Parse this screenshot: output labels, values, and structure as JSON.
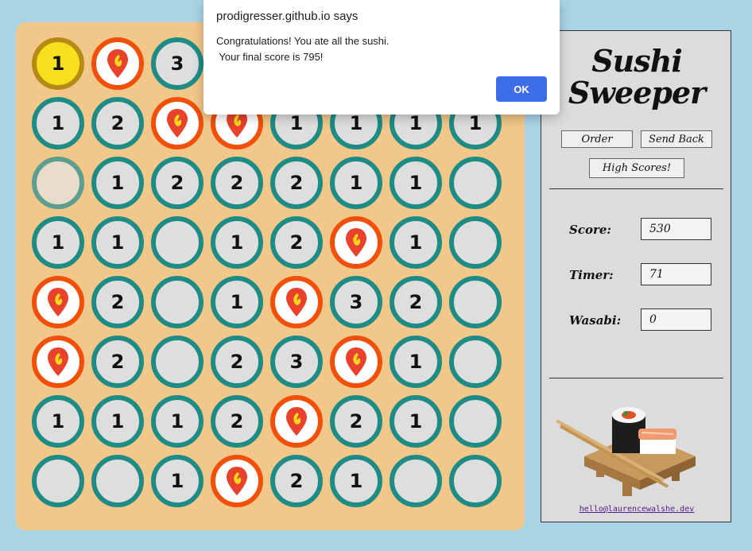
{
  "board": {
    "rows": [
      [
        "1",
        "sushi",
        "3",
        "",
        "",
        "",
        "",
        ""
      ],
      [
        "1",
        "2",
        "sushi",
        "sushi",
        "1",
        "1",
        "1",
        "1"
      ],
      [
        "",
        "1",
        "2",
        "2",
        "2",
        "1",
        "1",
        ""
      ],
      [
        "1",
        "1",
        "",
        "1",
        "2",
        "sushi",
        "1",
        ""
      ],
      [
        "sushi",
        "2",
        "",
        "1",
        "sushi",
        "3",
        "2",
        ""
      ],
      [
        "sushi",
        "2",
        "",
        "2",
        "3",
        "sushi",
        "1",
        ""
      ],
      [
        "1",
        "1",
        "1",
        "2",
        "sushi",
        "2",
        "1",
        ""
      ],
      [
        "",
        "",
        "1",
        "sushi",
        "2",
        "1",
        "",
        ""
      ]
    ],
    "highlighted_cell": "1",
    "sushi_icon": "sushi-icon",
    "colors": {
      "cell_border": "#1e8c84",
      "sushi_border": "#f0500a",
      "highlight_fill": "#f8e01e",
      "board_bg": "#f2c78a"
    }
  },
  "panel": {
    "title_line1": "Sushi",
    "title_line2": "Sweeper",
    "buttons": {
      "order": "Order",
      "send_back": "Send Back",
      "high_scores": "High Scores!"
    },
    "stats": {
      "score_label": "Score:",
      "score_value": "530",
      "timer_label": "Timer:",
      "timer_value": "71",
      "wasabi_label": "Wasabi:",
      "wasabi_value": "0"
    },
    "email": "hello@laurencewalshe.dev"
  },
  "dialog": {
    "title": "prodigresser.github.io says",
    "message": "Congratulations! You ate all the sushi.\n Your final score is 795!",
    "ok_label": "OK"
  }
}
